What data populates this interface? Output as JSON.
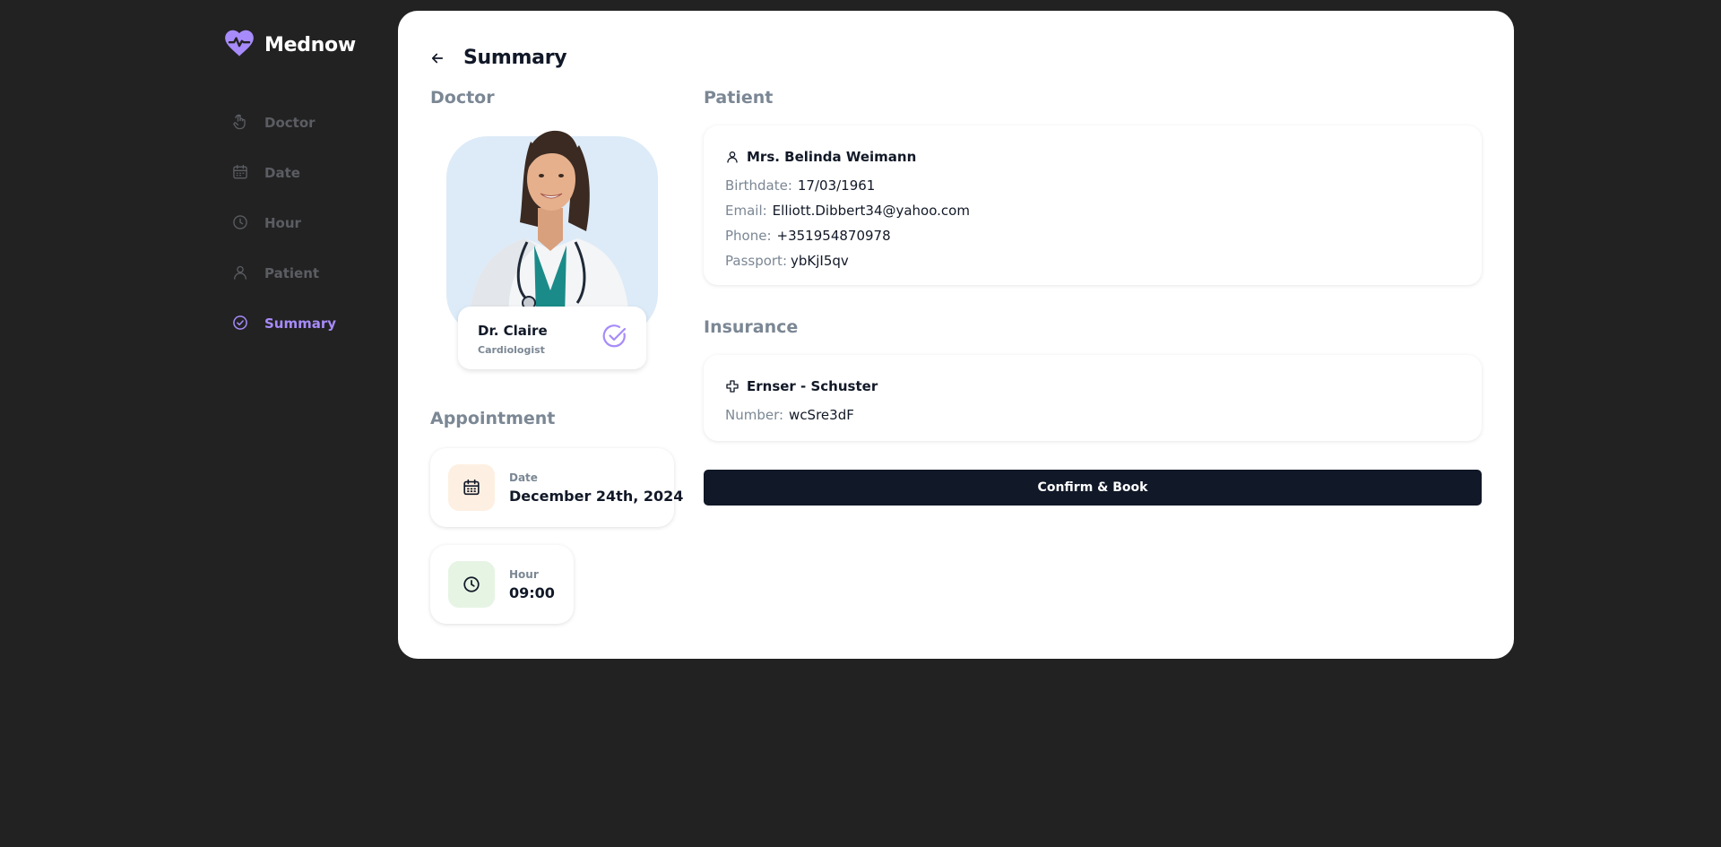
{
  "brand": {
    "name": "Mednow",
    "logo_icon": "heart-pulse-icon",
    "color": "#a78bfa"
  },
  "sidebar": {
    "items": [
      {
        "label": "Doctor",
        "icon": "hand-pointer-icon",
        "active": false
      },
      {
        "label": "Date",
        "icon": "calendar-icon",
        "active": false
      },
      {
        "label": "Hour",
        "icon": "clock-icon",
        "active": false
      },
      {
        "label": "Patient",
        "icon": "user-icon",
        "active": false
      },
      {
        "label": "Summary",
        "icon": "check-circle-icon",
        "active": true
      }
    ]
  },
  "page": {
    "title": "Summary",
    "back_icon": "arrow-left-icon"
  },
  "doctor": {
    "section_label": "Doctor",
    "name": "Dr. Claire",
    "specialty": "Cardiologist",
    "check_icon": "check-circle-icon"
  },
  "appointment": {
    "section_label": "Appointment",
    "date_label": "Date",
    "date_value": "December 24th, 2024",
    "hour_label": "Hour",
    "hour_value": "09:00"
  },
  "patient": {
    "section_label": "Patient",
    "name": "Mrs. Belinda Weimann",
    "birthdate_label": "Birthdate:",
    "birthdate": "17/03/1961",
    "email_label": "Email:",
    "email": "Elliott.Dibbert34@yahoo.com",
    "phone_label": "Phone:",
    "phone": "+351954870978",
    "passport_label": "Passport:",
    "passport": "ybKjI5qv"
  },
  "insurance": {
    "section_label": "Insurance",
    "name": "Ernser - Schuster",
    "number_label": "Number:",
    "number": "wcSre3dF"
  },
  "actions": {
    "confirm_label": "Confirm & Book"
  },
  "colors": {
    "background": "#222222",
    "accent": "#a78bfa",
    "primary_button": "#111827",
    "date_tile": "#fdf0e2",
    "hour_tile": "#e6f4e4",
    "doctor_bg": "#ddebf8"
  }
}
